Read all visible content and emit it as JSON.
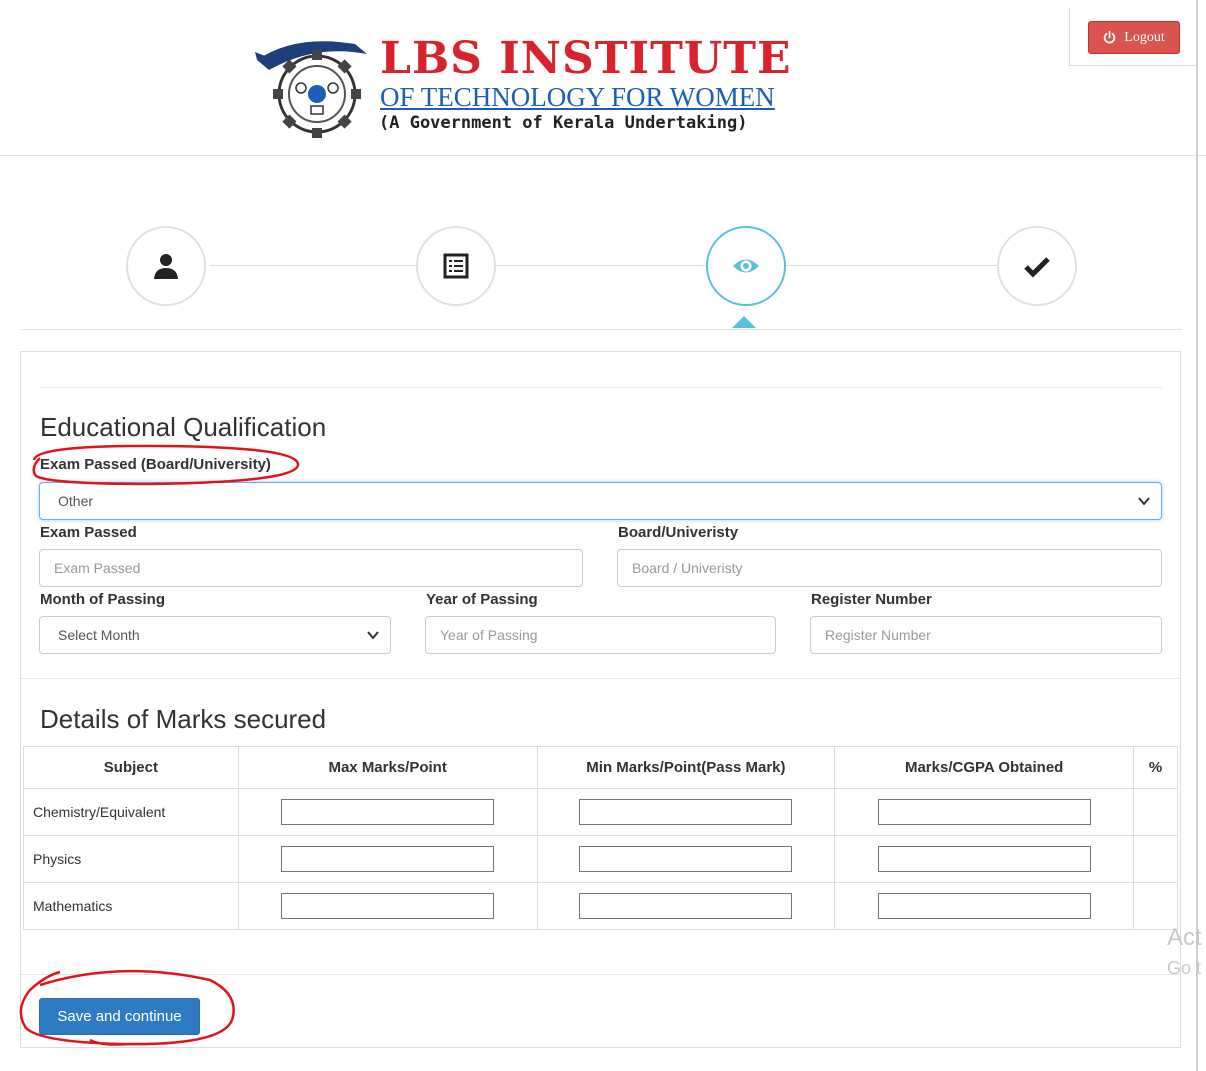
{
  "header": {
    "logo_title": "LBS INSTITUTE",
    "logo_subtitle": "OF TECHNOLOGY FOR WOMEN",
    "logo_tagline": "(A Government of Kerala Undertaking)",
    "logout_label": "Logout"
  },
  "steps": [
    {
      "icon": "user-icon",
      "active": false
    },
    {
      "icon": "list-icon",
      "active": false
    },
    {
      "icon": "eye-icon",
      "active": true
    },
    {
      "icon": "checkmark-icon",
      "active": false
    }
  ],
  "education": {
    "title": "Educational Qualification",
    "exam_board_label": "Exam Passed (Board/University)",
    "exam_board_value": "Other",
    "exam_passed_label": "Exam Passed",
    "exam_passed_placeholder": "Exam Passed",
    "board_label": "Board/Univeristy",
    "board_placeholder": "Board / Univeristy",
    "month_label": "Month of Passing",
    "month_value": "Select Month",
    "year_label": "Year of Passing",
    "year_placeholder": "Year of Passing",
    "register_label": "Register Number",
    "register_placeholder": "Register Number"
  },
  "marks": {
    "title": "Details of Marks secured",
    "columns": [
      "Subject",
      "Max Marks/Point",
      "Min Marks/Point(Pass Mark)",
      "Marks/CGPA Obtained",
      "%"
    ],
    "rows": [
      {
        "subject": "Chemistry/Equivalent"
      },
      {
        "subject": "Physics"
      },
      {
        "subject": "Mathematics"
      }
    ]
  },
  "actions": {
    "save_label": "Save and continue"
  },
  "watermark": {
    "line1": "Act",
    "line2": "Go t"
  },
  "colors": {
    "logo_red": "#d8222c",
    "logo_blue": "#1d5fb8",
    "logout_red": "#d9534f",
    "primary_blue": "#2e7bc4",
    "step_active": "#5bc0de",
    "annotation_red": "#e0141e"
  }
}
